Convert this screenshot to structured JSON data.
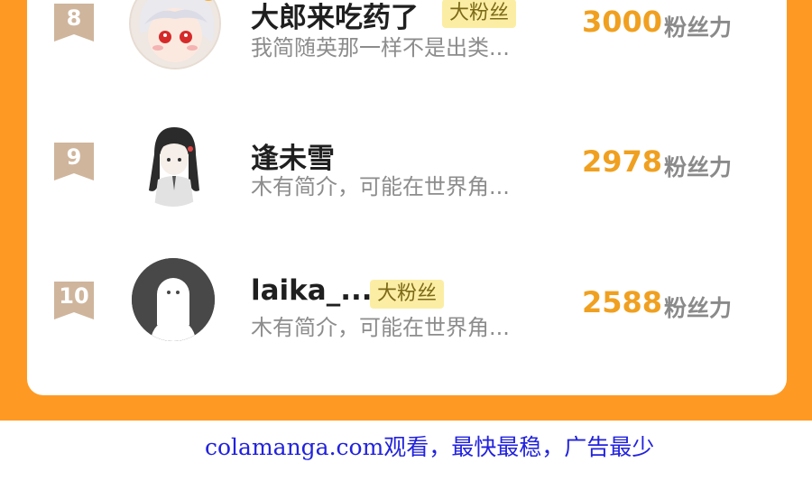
{
  "colors": {
    "background_accent": "#fe9a23",
    "score": "#f0a020",
    "badge_bg": "#fbeea4",
    "ribbon": "#cfb59c",
    "footer_link": "#2222dd"
  },
  "ranking": [
    {
      "rank": "8",
      "nickname": "大郎来吃药了",
      "badge": "大粉丝",
      "intro": "我简随英那一样不是出类...",
      "score": "3000",
      "score_unit": "粉丝力"
    },
    {
      "rank": "9",
      "nickname": "逢未雪",
      "badge": "",
      "intro": "木有简介，可能在世界角...",
      "score": "2978",
      "score_unit": "粉丝力"
    },
    {
      "rank": "10",
      "nickname": "laika_...",
      "badge": "大粉丝",
      "intro": "木有简介，可能在世界角...",
      "score": "2588",
      "score_unit": "粉丝力"
    }
  ],
  "footer": {
    "text": "colamanga.com观看，最快最稳，广告最少"
  }
}
